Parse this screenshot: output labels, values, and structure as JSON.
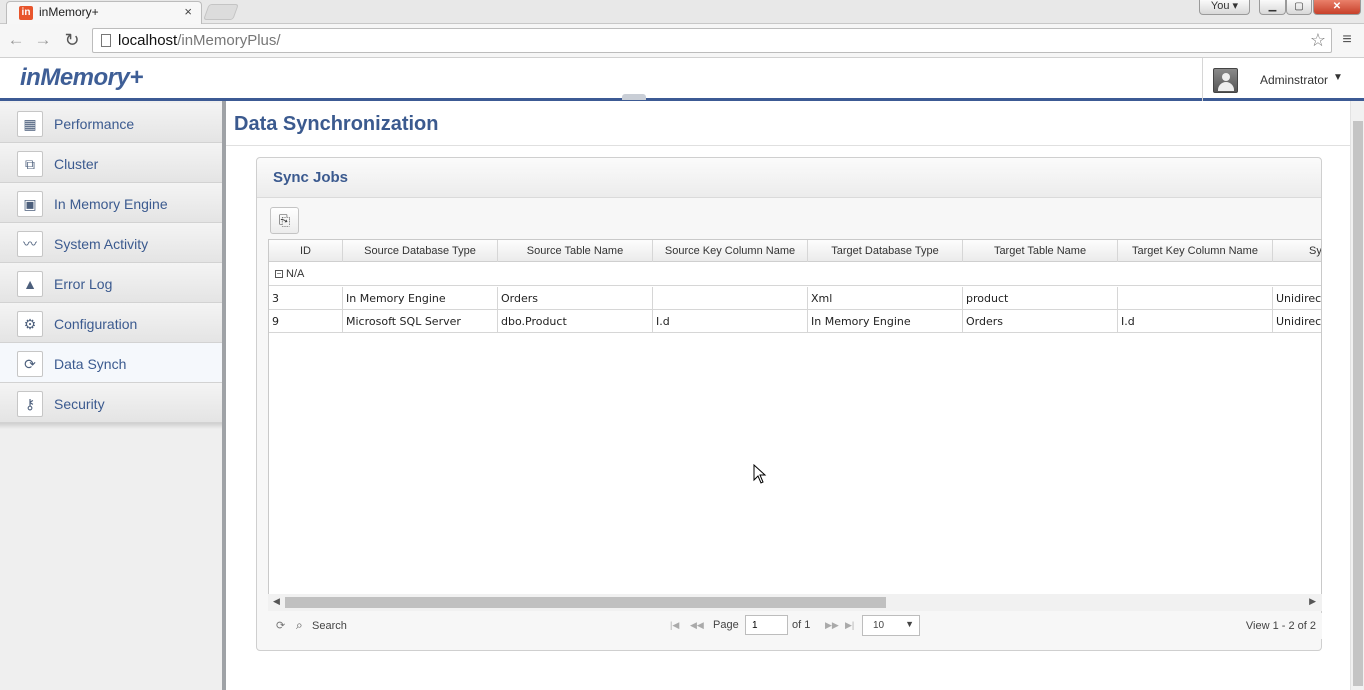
{
  "browser": {
    "tab_title": "inMemory+",
    "tab_close": "×",
    "favicon": "in",
    "user_badge": "You ▾",
    "win_min": "▁",
    "win_max": "▢",
    "win_close": "✕",
    "url_host": "localhost",
    "url_path": "/inMemoryPlus/",
    "icons": [
      "back-icon",
      "forward-icon",
      "reload-icon",
      "page-icon",
      "star-icon",
      "menu-icon"
    ]
  },
  "app": {
    "brand": "inMemory+",
    "user_name": "Adminstrator",
    "colors": {
      "brand": "#3e5e96",
      "header_bar": "#3c5a94"
    }
  },
  "sidebar": {
    "items": [
      {
        "label": "Performance",
        "icon": "performance-icon",
        "glyph": "▦"
      },
      {
        "label": "Cluster",
        "icon": "cluster-icon",
        "glyph": "⧉"
      },
      {
        "label": "In Memory Engine",
        "icon": "chip-icon",
        "glyph": "▣"
      },
      {
        "label": "System Activity",
        "icon": "activity-icon",
        "glyph": "〰"
      },
      {
        "label": "Error Log",
        "icon": "warning-icon",
        "glyph": "▲"
      },
      {
        "label": "Configuration",
        "icon": "gear-icon",
        "glyph": "⚙"
      },
      {
        "label": "Data Synch",
        "icon": "sync-icon",
        "glyph": "⟳"
      },
      {
        "label": "Security",
        "icon": "key-icon",
        "glyph": "⚷"
      }
    ],
    "active": "Data Synch"
  },
  "main": {
    "title": "Data Synchronization",
    "panel_title": "Sync Jobs",
    "add_button_glyph": "⎘",
    "grid": {
      "columns": [
        "ID",
        "Source Database Type",
        "Source Table Name",
        "Source Key Column Name",
        "Target Database Type",
        "Target Table Name",
        "Target Key Column Name",
        "Sy"
      ],
      "group_toggle": "−",
      "group_label": "N/A",
      "rows": [
        [
          "3",
          "In Memory Engine",
          "Orders",
          "",
          "Xml",
          "product",
          "",
          "Unidirec"
        ],
        [
          "9",
          "Microsoft SQL Server",
          "dbo.Product",
          "I.d",
          "In Memory Engine",
          "Orders",
          "I.d",
          "Unidirec"
        ]
      ]
    },
    "pager": {
      "search_label": "Search",
      "page_label": "Page",
      "page_value": "1",
      "of_label": "of 1",
      "page_size": "10",
      "view_info": "View 1 - 2 of 2"
    }
  }
}
